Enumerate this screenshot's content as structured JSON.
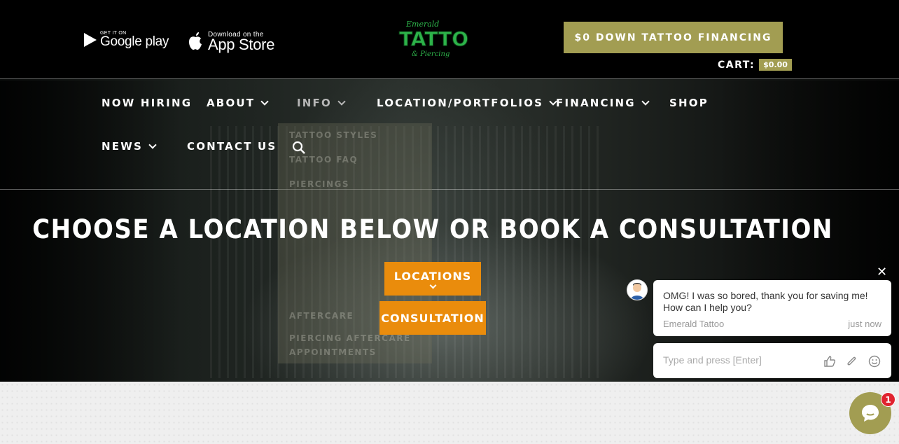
{
  "header": {
    "google_play_sub": "GET IT ON",
    "google_play_main": "Google play",
    "app_store_sub": "Download on the",
    "app_store_main": "App Store",
    "logo_text_top": "Emerald",
    "logo_text_main": "TATTOO",
    "logo_text_bottom": "& Piercing",
    "financing_button": "$0 DOWN TATTOO FINANCING",
    "cart_label": "CART:",
    "cart_amount": "$0.00"
  },
  "nav": {
    "items": [
      {
        "label": "NOW HIRING"
      },
      {
        "label": "ABOUT"
      },
      {
        "label": "INFO"
      },
      {
        "label": "LOCATION/PORTFOLIOS"
      },
      {
        "label": "FINANCING"
      },
      {
        "label": "SHOP"
      },
      {
        "label": "NEWS"
      },
      {
        "label": "CONTACT US"
      }
    ],
    "info_dropdown": [
      "TATTOO STYLES",
      "TATTOO FAQ",
      "PIERCINGS",
      "AFTERCARE",
      "PIERCING AFTERCARE",
      "APPOINTMENTS"
    ]
  },
  "hero": {
    "headline": "CHOOSE A LOCATION BELOW OR BOOK A CONSULTATION",
    "locations_button": "LOCATIONS",
    "consultation_button": "CONSULTATION"
  },
  "chat": {
    "message": "OMG! I was so bored, thank you for saving me! How can I help you?",
    "sender": "Emerald Tattoo",
    "time": "just now",
    "input_placeholder": "Type and press [Enter]",
    "unread_count": "1"
  },
  "colors": {
    "accent_olive": "#a29d52",
    "accent_orange": "#ea8c0c",
    "badge_red": "#e0232f"
  }
}
